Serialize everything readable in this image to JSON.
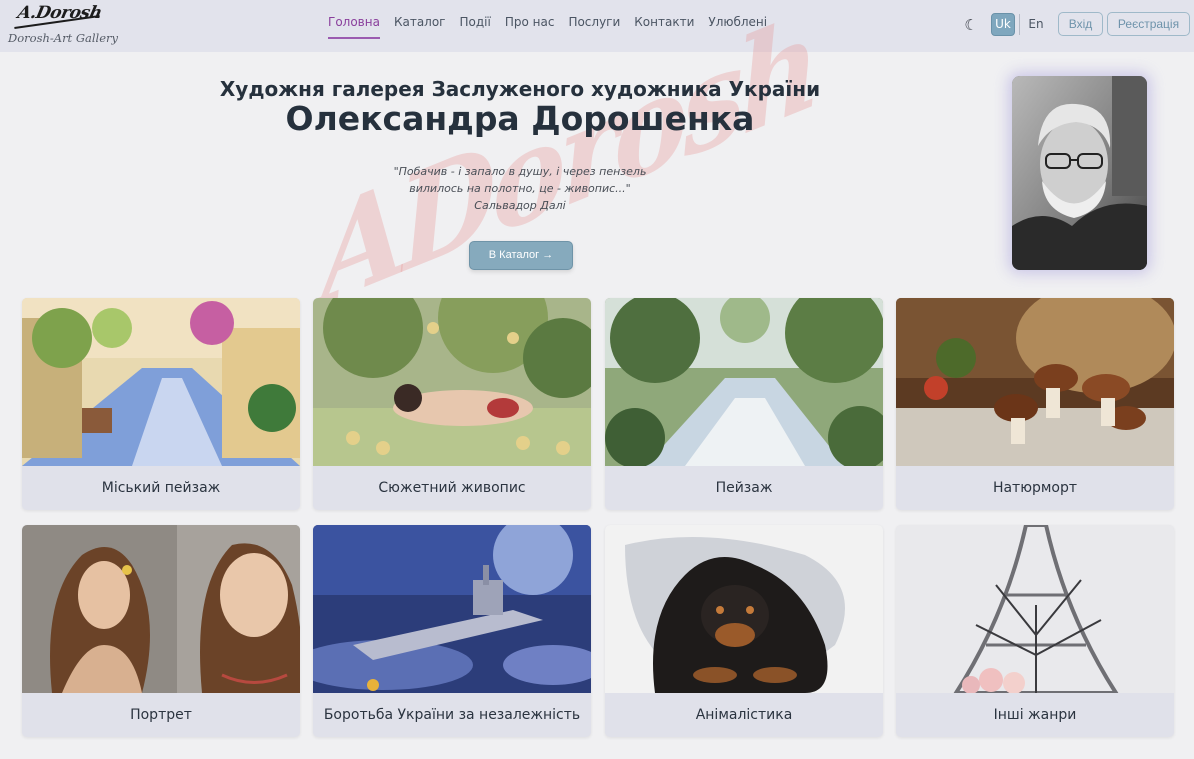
{
  "brand": {
    "signature": "A.Dorosh",
    "name": "Dorosh-Art Gallery"
  },
  "nav": {
    "items": [
      {
        "label": "Головна",
        "active": true
      },
      {
        "label": "Каталог",
        "active": false
      },
      {
        "label": "Події",
        "active": false
      },
      {
        "label": "Про нас",
        "active": false
      },
      {
        "label": "Послуги",
        "active": false
      },
      {
        "label": "Контакти",
        "active": false
      },
      {
        "label": "Улюблені",
        "active": false
      }
    ]
  },
  "header_right": {
    "theme_icon": "moon-icon",
    "lang_uk": "Uk",
    "lang_en": "En",
    "login_label": "Вхід",
    "register_label": "Реєстрація"
  },
  "hero": {
    "subtitle": "Художня галерея Заслуженого художника України",
    "title": "Олександра Дорошенка",
    "quote_line1": "\"Побачив - і запало в душу, і через пензель",
    "quote_line2": "вилилось на полотно, це - живопис...\"",
    "quote_author": "Сальвадор Далі",
    "catalog_button": "В Каталог",
    "watermark": "ADorosh"
  },
  "categories": [
    {
      "label": "Міський пейзаж"
    },
    {
      "label": "Сюжетний живопис"
    },
    {
      "label": "Пейзаж"
    },
    {
      "label": "Натюрморт"
    },
    {
      "label": "Портрет"
    },
    {
      "label": "Боротьба України за незалежність"
    },
    {
      "label": "Анімалістика"
    },
    {
      "label": "Інші жанри"
    }
  ],
  "colors": {
    "accent_active": "#8a3f9c",
    "button_primary": "#86aabd",
    "header_bg": "#e2e3ec"
  }
}
